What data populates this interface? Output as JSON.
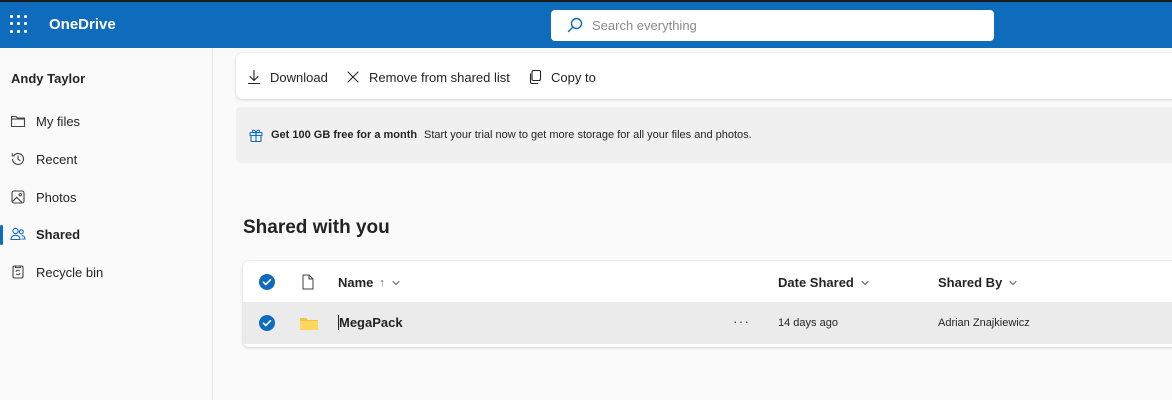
{
  "app": {
    "name": "OneDrive"
  },
  "search": {
    "placeholder": "Search everything"
  },
  "sidebar": {
    "user": "Andy Taylor",
    "items": [
      {
        "label": "My files",
        "icon": "folder-icon"
      },
      {
        "label": "Recent",
        "icon": "history-icon"
      },
      {
        "label": "Photos",
        "icon": "image-icon"
      },
      {
        "label": "Shared",
        "icon": "people-icon",
        "active": true
      },
      {
        "label": "Recycle bin",
        "icon": "recycle-bin-icon"
      }
    ]
  },
  "commandbar": {
    "download": "Download",
    "remove": "Remove from shared list",
    "copy": "Copy to"
  },
  "banner": {
    "title": "Get 100 GB free for a month",
    "description": "Start your trial now to get more storage for all your files and photos."
  },
  "main": {
    "title": "Shared with you"
  },
  "table": {
    "headers": {
      "name": "Name",
      "name_sort": "↑",
      "date": "Date Shared",
      "by": "Shared By"
    },
    "rows": [
      {
        "name": "MegaPack",
        "date": "14 days ago",
        "by": "Adrian Znajkiewicz",
        "more": "···"
      }
    ]
  },
  "colors": {
    "brand": "#0f6cbd",
    "folder": "#f5c342"
  }
}
